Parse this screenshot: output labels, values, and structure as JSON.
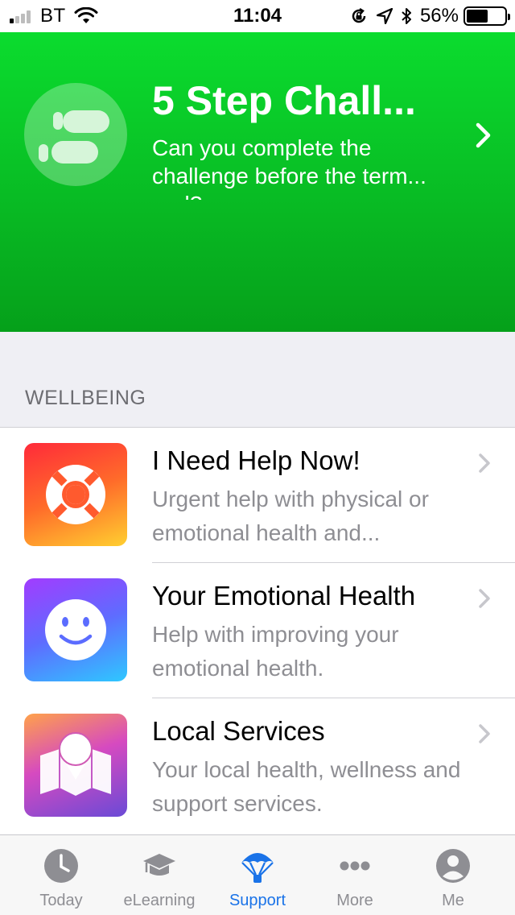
{
  "status_bar": {
    "carrier": "BT",
    "time": "11:04",
    "battery_percent": "56%",
    "battery_level": 0.56,
    "icons": [
      "signal-icon",
      "wifi-icon",
      "orientation-lock-icon",
      "location-icon",
      "bluetooth-icon",
      "battery-icon"
    ]
  },
  "hero": {
    "icon": "footsteps-icon",
    "title": "5 Step Chall...",
    "subtitle": "Can you complete the challenge before the term... end?"
  },
  "wellbeing": {
    "header": "WELLBEING",
    "items": [
      {
        "title": "I Need Help Now!",
        "subtitle": "Urgent help with physical or emotional health and...",
        "icon": "lifebuoy-icon"
      },
      {
        "title": "Your Emotional Health",
        "subtitle": "Help with improving your emotional health.",
        "icon": "smiley-icon"
      },
      {
        "title": "Local Services",
        "subtitle": "Your local health, wellness and support services.",
        "icon": "map-pin-icon"
      }
    ]
  },
  "tab_bar": {
    "active": "Support",
    "active_color": "#1a73e8",
    "inactive_color": "#8e8e93",
    "tabs": [
      {
        "label": "Today",
        "icon": "clock-icon"
      },
      {
        "label": "eLearning",
        "icon": "graduation-cap-icon"
      },
      {
        "label": "Support",
        "icon": "parachute-icon"
      },
      {
        "label": "More",
        "icon": "more-dots-icon"
      },
      {
        "label": "Me",
        "icon": "person-icon"
      }
    ]
  },
  "colors": {
    "hero_green": "#09c226",
    "background": "#efeff4",
    "secondary_text": "#8e8e93"
  }
}
